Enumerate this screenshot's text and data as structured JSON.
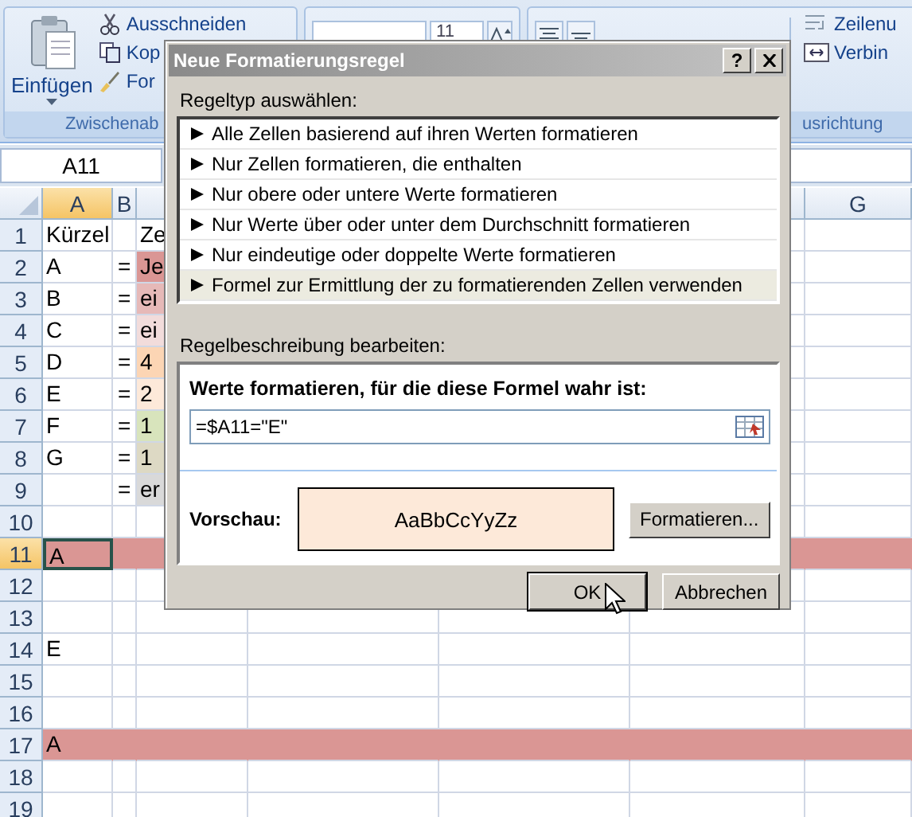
{
  "ribbon": {
    "clipboard": {
      "paste_label": "Einfügen",
      "items": [
        {
          "kind": "cut",
          "label": "Ausschneiden"
        },
        {
          "kind": "copy",
          "label": "Kop"
        },
        {
          "kind": "brush",
          "label": "For"
        }
      ],
      "group_label": "Zwischenab"
    },
    "font": {
      "size": "11"
    },
    "alignment": {
      "items": [
        {
          "kind": "wrap",
          "label": "Zeilenu"
        },
        {
          "kind": "merge",
          "label": "Verbin"
        }
      ],
      "group_label": "usrichtung"
    }
  },
  "name_box": "A11",
  "columns": [
    {
      "label": "A",
      "selected": true
    },
    {
      "label": "B",
      "selected": false
    },
    {
      "label": "G",
      "selected": false
    }
  ],
  "rows": [
    {
      "number": "1",
      "selected": false,
      "highlighted": false,
      "a": "Kürzel",
      "c": "Ze"
    },
    {
      "number": "2",
      "selected": false,
      "highlighted": false,
      "a": "A",
      "b": "=",
      "c": "Je",
      "color": "#da9694"
    },
    {
      "number": "3",
      "selected": false,
      "highlighted": false,
      "a": "B",
      "b": "=",
      "c": "ei",
      "color": "#e6b9b8"
    },
    {
      "number": "4",
      "selected": false,
      "highlighted": false,
      "a": "C",
      "b": "=",
      "c": "ei",
      "color": "#f2dcdb"
    },
    {
      "number": "5",
      "selected": false,
      "highlighted": false,
      "a": "D",
      "b": "=",
      "c": "4",
      "color": "#fcd5b4"
    },
    {
      "number": "6",
      "selected": false,
      "highlighted": false,
      "a": "E",
      "b": "=",
      "c": "2",
      "color": "#fde9d9"
    },
    {
      "number": "7",
      "selected": false,
      "highlighted": false,
      "a": "F",
      "b": "=",
      "c": "1",
      "color": "#d8e4bc"
    },
    {
      "number": "8",
      "selected": false,
      "highlighted": false,
      "a": "G",
      "b": "=",
      "c": "1",
      "color": "#ddd9c4"
    },
    {
      "number": "9",
      "selected": false,
      "highlighted": false,
      "b": "=",
      "c": "er",
      "color": "#d9d9d9"
    },
    {
      "number": "10",
      "selected": false,
      "highlighted": false
    },
    {
      "number": "11",
      "selected": true,
      "highlighted": true,
      "a": "A"
    },
    {
      "number": "12",
      "selected": false,
      "highlighted": false
    },
    {
      "number": "13",
      "selected": false,
      "highlighted": false
    },
    {
      "number": "14",
      "selected": false,
      "highlighted": false,
      "a": "E"
    },
    {
      "number": "15",
      "selected": false,
      "highlighted": false
    },
    {
      "number": "16",
      "selected": false,
      "highlighted": false
    },
    {
      "number": "17",
      "selected": false,
      "highlighted": true,
      "a": "A"
    },
    {
      "number": "18",
      "selected": false,
      "highlighted": false
    },
    {
      "number": "19",
      "selected": false,
      "highlighted": false
    }
  ],
  "dialog": {
    "title": "Neue Formatierungsregel",
    "help": "?",
    "rule_type_label": "Regeltyp auswählen:",
    "rule_types": [
      {
        "label": "Alle Zellen basierend auf ihren Werten formatieren",
        "selected": false
      },
      {
        "label": "Nur Zellen formatieren, die enthalten",
        "selected": false
      },
      {
        "label": "Nur obere oder untere Werte formatieren",
        "selected": false
      },
      {
        "label": "Nur Werte über oder unter dem Durchschnitt formatieren",
        "selected": false
      },
      {
        "label": "Nur eindeutige oder doppelte Werte formatieren",
        "selected": false
      },
      {
        "label": "Formel zur Ermittlung der zu formatierenden Zellen verwenden",
        "selected": true
      }
    ],
    "description_label": "Regelbeschreibung bearbeiten:",
    "formula_heading": "Werte formatieren, für die diese Formel wahr ist:",
    "formula": "=$A11=\"E\"",
    "preview_label": "Vorschau:",
    "preview_sample": "AaBbCcYyZz",
    "format_button": "Formatieren...",
    "ok": "OK",
    "cancel": "Abbrechen"
  }
}
